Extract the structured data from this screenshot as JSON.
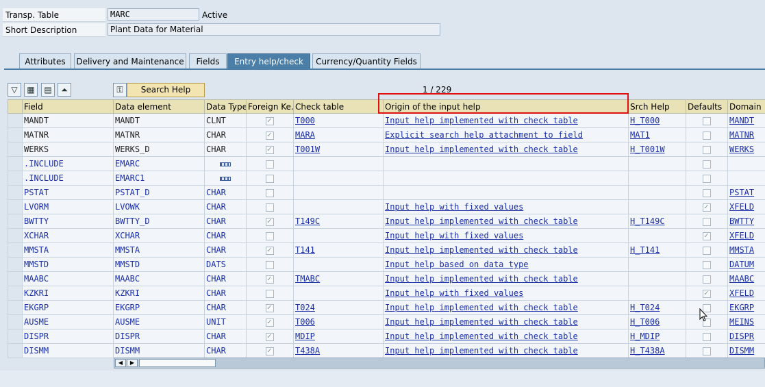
{
  "header": {
    "table_label": "Transp. Table",
    "table_value": "MARC",
    "status": "Active",
    "desc_label": "Short Description",
    "desc_value": "Plant Data for Material"
  },
  "tabs": [
    {
      "label": "Attributes"
    },
    {
      "label": "Delivery and Maintenance"
    },
    {
      "label": "Fields"
    },
    {
      "label": "Entry help/check",
      "active": true
    },
    {
      "label": "Currency/Quantity Fields"
    }
  ],
  "toolbar": {
    "search_help_label": "Search Help",
    "pager": "1  /  229"
  },
  "columns": [
    "Field",
    "Data element",
    "Data Type",
    "Foreign Ke...",
    "Check table",
    "Origin of the input help",
    "Srch Help",
    "Defaults",
    "Domain"
  ],
  "rows": [
    {
      "field": "MANDT",
      "element": "MANDT",
      "dtype": "CLNT",
      "fk": true,
      "check": "T000",
      "origin": "Input help implemented with check table",
      "srch": "H_T000",
      "def": false,
      "domain": "MANDT",
      "style": "dark"
    },
    {
      "field": "MATNR",
      "element": "MATNR",
      "dtype": "CHAR",
      "fk": true,
      "check": "MARA",
      "origin": "Explicit search help attachment to field",
      "srch": "MAT1",
      "def": false,
      "domain": "MATNR",
      "style": "dark"
    },
    {
      "field": "WERKS",
      "element": "WERKS_D",
      "dtype": "CHAR",
      "fk": true,
      "check": "T001W",
      "origin": "Input help implemented with check table",
      "srch": "H_T001W",
      "def": false,
      "domain": "WERKS",
      "style": "dark"
    },
    {
      "field": ".INCLUDE",
      "element": "EMARC",
      "dtype": "",
      "fk": false,
      "check": "",
      "origin": "",
      "srch": "",
      "def": false,
      "domain": "",
      "style": "include"
    },
    {
      "field": ".INCLUDE",
      "element": "EMARC1",
      "dtype": "",
      "fk": false,
      "check": "",
      "origin": "",
      "srch": "",
      "def": false,
      "domain": "",
      "style": "include"
    },
    {
      "field": "PSTAT",
      "element": "PSTAT_D",
      "dtype": "CHAR",
      "fk": false,
      "check": "",
      "origin": "",
      "srch": "",
      "def": false,
      "domain": "PSTAT",
      "style": "blue"
    },
    {
      "field": "LVORM",
      "element": "LVOWK",
      "dtype": "CHAR",
      "fk": false,
      "check": "",
      "origin": "Input help with fixed values",
      "srch": "",
      "def": true,
      "domain": "XFELD",
      "style": "blue"
    },
    {
      "field": "BWTTY",
      "element": "BWTTY_D",
      "dtype": "CHAR",
      "fk": true,
      "check": "T149C",
      "origin": "Input help implemented with check table",
      "srch": "H_T149C",
      "def": false,
      "domain": "BWTTY",
      "style": "blue"
    },
    {
      "field": "XCHAR",
      "element": "XCHAR",
      "dtype": "CHAR",
      "fk": false,
      "check": "",
      "origin": "Input help with fixed values",
      "srch": "",
      "def": true,
      "domain": "XFELD",
      "style": "blue"
    },
    {
      "field": "MMSTA",
      "element": "MMSTA",
      "dtype": "CHAR",
      "fk": true,
      "check": "T141",
      "origin": "Input help implemented with check table",
      "srch": "H_T141",
      "def": false,
      "domain": "MMSTA",
      "style": "blue"
    },
    {
      "field": "MMSTD",
      "element": "MMSTD",
      "dtype": "DATS",
      "fk": false,
      "check": "",
      "origin": "Input help based on data type",
      "srch": "",
      "def": false,
      "domain": "DATUM",
      "style": "blue"
    },
    {
      "field": "MAABC",
      "element": "MAABC",
      "dtype": "CHAR",
      "fk": true,
      "check": "TMABC",
      "origin": "Input help implemented with check table",
      "srch": "",
      "def": false,
      "domain": "MAABC",
      "style": "blue"
    },
    {
      "field": "KZKRI",
      "element": "KZKRI",
      "dtype": "CHAR",
      "fk": false,
      "check": "",
      "origin": "Input help with fixed values",
      "srch": "",
      "def": true,
      "domain": "XFELD",
      "style": "blue"
    },
    {
      "field": "EKGRP",
      "element": "EKGRP",
      "dtype": "CHAR",
      "fk": true,
      "check": "T024",
      "origin": "Input help implemented with check table",
      "srch": "H_T024",
      "def": false,
      "domain": "EKGRP",
      "style": "blue"
    },
    {
      "field": "AUSME",
      "element": "AUSME",
      "dtype": "UNIT",
      "fk": true,
      "check": "T006",
      "origin": "Input help implemented with check table",
      "srch": "H_T006",
      "def": false,
      "domain": "MEINS",
      "style": "blue"
    },
    {
      "field": "DISPR",
      "element": "DISPR",
      "dtype": "CHAR",
      "fk": true,
      "check": "MDIP",
      "origin": "Input help implemented with check table",
      "srch": "H_MDIP",
      "def": false,
      "domain": "DISPR",
      "style": "blue"
    },
    {
      "field": "DISMM",
      "element": "DISMM",
      "dtype": "CHAR",
      "fk": true,
      "check": "T438A",
      "origin": "Input help implemented with check table",
      "srch": "H_T438A",
      "def": false,
      "domain": "DISMM",
      "style": "blue"
    }
  ]
}
